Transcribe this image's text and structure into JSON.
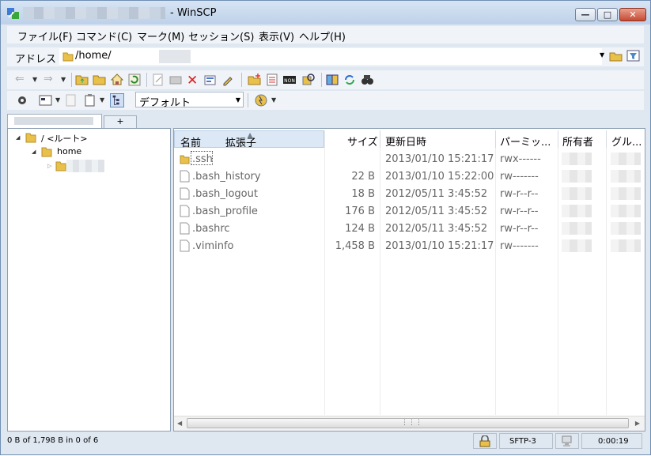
{
  "window": {
    "title": "- WinSCP"
  },
  "menu": [
    "ファイル(F)",
    "コマンド(C)",
    "マーク(M)",
    "セッション(S)",
    "表示(V)",
    "ヘルプ(H)"
  ],
  "address": {
    "label": "アドレス",
    "path": "/home/"
  },
  "toolbar": {
    "filter": "デフォルト"
  },
  "tabs": {
    "new_tab": "+"
  },
  "tree": [
    {
      "label": "/ <ルート>"
    },
    {
      "label": "home"
    }
  ],
  "columns": [
    {
      "label": "名前"
    },
    {
      "label": "拡張子"
    },
    {
      "label": "サイズ"
    },
    {
      "label": "更新日時"
    },
    {
      "label": "パーミッ..."
    },
    {
      "label": "所有者"
    },
    {
      "label": "グル..."
    }
  ],
  "files": [
    {
      "name": ".ssh",
      "size": "",
      "modified": "2013/01/10 15:21:17",
      "perm": "rwx------",
      "type": "folder"
    },
    {
      "name": ".bash_history",
      "size": "22 B",
      "modified": "2013/01/10 15:22:00",
      "perm": "rw-------",
      "type": "file"
    },
    {
      "name": ".bash_logout",
      "size": "18 B",
      "modified": "2012/05/11 3:45:52",
      "perm": "rw-r--r--",
      "type": "file"
    },
    {
      "name": ".bash_profile",
      "size": "176 B",
      "modified": "2012/05/11 3:45:52",
      "perm": "rw-r--r--",
      "type": "file"
    },
    {
      "name": ".bashrc",
      "size": "124 B",
      "modified": "2012/05/11 3:45:52",
      "perm": "rw-r--r--",
      "type": "file"
    },
    {
      "name": ".viminfo",
      "size": "1,458 B",
      "modified": "2013/01/10 15:21:17",
      "perm": "rw-------",
      "type": "file"
    }
  ],
  "status": {
    "selection": "0 B of 1,798 B in 0 of 6",
    "protocol": "SFTP-3",
    "elapsed": "0:00:19"
  },
  "colors": {
    "folder": "#e8c04a",
    "accent": "#dce8f6"
  }
}
